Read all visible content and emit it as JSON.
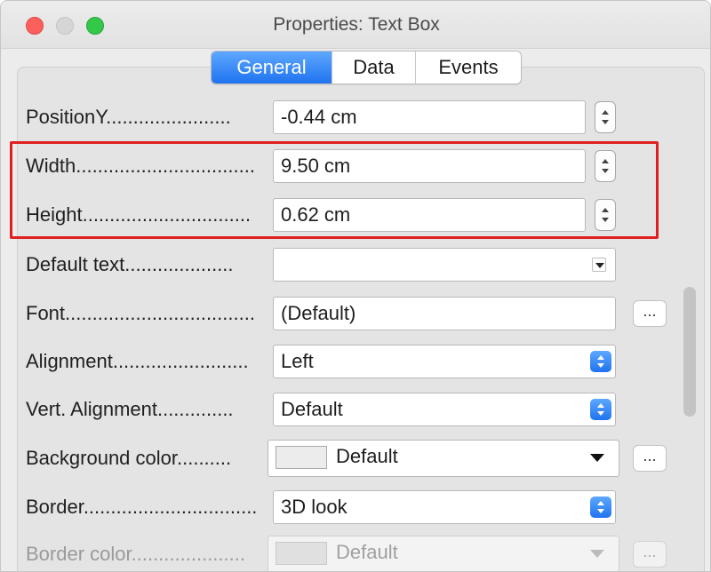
{
  "window": {
    "title": "Properties: Text Box"
  },
  "tabs": [
    {
      "label": "General",
      "active": true
    },
    {
      "label": "Data",
      "active": false
    },
    {
      "label": "Events",
      "active": false
    }
  ],
  "fields": {
    "position_y": {
      "label": "PositionY.......................",
      "value": "-0.44 cm"
    },
    "width": {
      "label": "Width.................................",
      "value": "9.50 cm"
    },
    "height": {
      "label": "Height...............................",
      "value": "0.62 cm"
    },
    "default_text": {
      "label": "Default text....................",
      "value": ""
    },
    "font": {
      "label": "Font...................................",
      "value": "(Default)",
      "button": "..."
    },
    "alignment": {
      "label": "Alignment.........................",
      "value": "Left"
    },
    "vert_alignment": {
      "label": "Vert. Alignment..............",
      "value": "Default"
    },
    "background_color": {
      "label": "Background color..........",
      "value": "Default",
      "button": "..."
    },
    "border": {
      "label": "Border................................",
      "value": "3D look"
    },
    "border_color": {
      "label": "Border color.....................",
      "value": "Default",
      "button": "..."
    }
  },
  "colors": {
    "accent": "#1f73f0",
    "highlight": "#e02020",
    "swatch_default": "#ececec"
  },
  "icons": {
    "spin": "up-down-spinner-icon",
    "combo": "blue-updown-chevron-icon",
    "dropdown": "triangle-down-icon"
  }
}
